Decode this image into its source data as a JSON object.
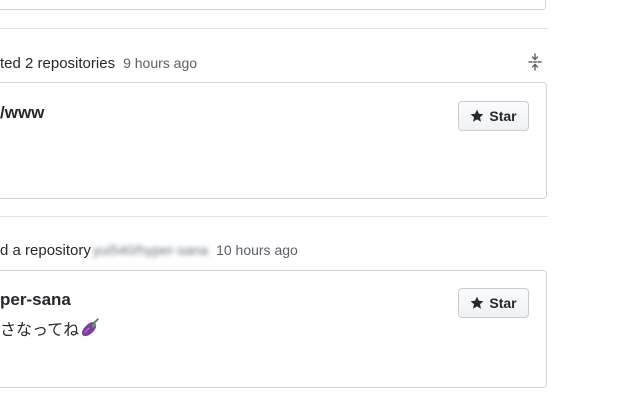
{
  "feed": [
    {
      "action_text": "ted 2 repositories",
      "time": "9 hours ago",
      "repo": {
        "name": "/www",
        "description": "",
        "star_label": "Star"
      }
    },
    {
      "action_text": "d a repository",
      "blurred_repo": "yui540/hyper-sana",
      "time": "10 hours ago",
      "repo": {
        "name": "per-sana",
        "description": "さなってね",
        "star_label": "Star"
      }
    }
  ],
  "icons": {
    "collapse": "unfold-icon",
    "star": "star-icon",
    "emoji": "eggplant-icon"
  },
  "colors": {
    "border": "#d1d5da",
    "muted_text": "#586069",
    "text": "#24292e",
    "emoji_purple": "#8e44ad"
  }
}
